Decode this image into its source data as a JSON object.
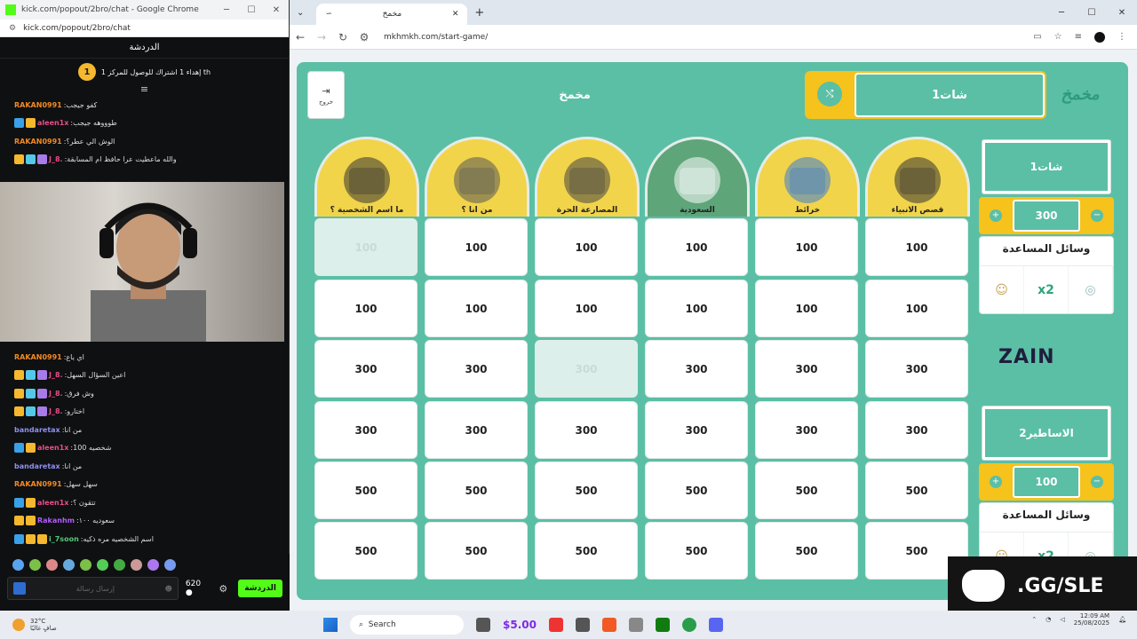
{
  "left_window": {
    "title": "kick.com/popout/2bro/chat - Google Chrome",
    "url": "kick.com/popout/2bro/chat",
    "chat_header": "الدردشة",
    "pinned": {
      "rank": "1",
      "text": "إهداء 1 اشتراك للوصول للمركز 1 th"
    },
    "messages_top": [
      {
        "user": "RAKAN0991",
        "text": "كفو جيجب",
        "color": "#f08a24",
        "badges": []
      },
      {
        "user": "aleen1x",
        "text": "طوووهه جيجب",
        "color": "#e84c8a",
        "badges": [
          "#3aa0e8",
          "#f5b82e"
        ]
      },
      {
        "user": "RAKAN0991",
        "text": "الوش الي عطر؟",
        "color": "#f08a24",
        "badges": []
      },
      {
        "user": "J_8.",
        "text": "والله ماعطيت عرا حافظ ام المسابقة",
        "color": "#e84c8a",
        "badges": [
          "#f5b82e",
          "#53c8e8",
          "#a77be8"
        ]
      }
    ],
    "messages_bottom": [
      {
        "user": "RAKAN0991",
        "text": "اي ياع",
        "color": "#f08a24",
        "badges": []
      },
      {
        "user": "J_8.",
        "text": "اعين السؤال السهل",
        "color": "#e84c8a",
        "badges": [
          "#f5b82e",
          "#53c8e8",
          "#a77be8"
        ]
      },
      {
        "user": "J_8.",
        "text": "وش فرق",
        "color": "#e84c8a",
        "badges": [
          "#f5b82e",
          "#53c8e8",
          "#a77be8"
        ]
      },
      {
        "user": "J_8.",
        "text": "اختارو",
        "color": "#e84c8a",
        "badges": [
          "#f5b82e",
          "#53c8e8",
          "#a77be8"
        ]
      },
      {
        "user": "bandaretax",
        "text": "من انا",
        "color": "#8f8ff0",
        "badges": []
      },
      {
        "user": "aleen1x",
        "text": "شخصيه 100",
        "color": "#e84c8a",
        "badges": [
          "#3aa0e8",
          "#f5b82e"
        ]
      },
      {
        "user": "bandaretax",
        "text": "من انا",
        "color": "#8f8ff0",
        "badges": []
      },
      {
        "user": "RAKAN0991",
        "text": "سهل سهل",
        "color": "#f08a24",
        "badges": []
      },
      {
        "user": "aleen1x",
        "text": "تتقون ؟",
        "color": "#e84c8a",
        "badges": [
          "#3aa0e8",
          "#f5b82e"
        ]
      },
      {
        "user": "Rakanhm",
        "text": "سعوديه ١٠٠",
        "color": "#b05cff",
        "badges": [
          "#f5b82e",
          "#f5b82e"
        ]
      },
      {
        "user": "i_7soon",
        "text": "اسم الشخصيه مره ذكيه",
        "color": "#53c87a",
        "badges": [
          "#3aa0e8",
          "#f5b82e",
          "#f5b82e"
        ]
      }
    ],
    "input_placeholder": "إرسال رسالة",
    "points": "620",
    "send_label": "الدردشة"
  },
  "browser": {
    "tab_title": "مخمخ",
    "url": "mkhmkh.com/start-game/"
  },
  "game": {
    "exit_label": "خروج",
    "title": "مخمخ",
    "current_team": "شات1",
    "logo": "مخمخ",
    "categories": [
      {
        "label": "ما اسم الشخصية ؟",
        "bg": "#f2d44a",
        "accent": "#333"
      },
      {
        "label": "من انا ؟",
        "bg": "#f2d44a",
        "accent": "#555"
      },
      {
        "label": "المصارعة الحرة",
        "bg": "#f2d44a",
        "accent": "#444"
      },
      {
        "label": "السعودية",
        "bg": "#5ea57a",
        "accent": "#fff"
      },
      {
        "label": "خرائط",
        "bg": "#f2d44a",
        "accent": "#3a7bd5"
      },
      {
        "label": "قصص الانبياء",
        "bg": "#f2d44a",
        "accent": "#333"
      }
    ],
    "rows": [
      [
        "100",
        "100",
        "100",
        "100",
        "100",
        "100"
      ],
      [
        "100",
        "100",
        "100",
        "100",
        "100",
        "100"
      ],
      [
        "300",
        "300",
        "300",
        "300",
        "300",
        "300"
      ],
      [
        "300",
        "300",
        "300",
        "300",
        "300",
        "300"
      ],
      [
        "500",
        "500",
        "500",
        "500",
        "500",
        "500"
      ],
      [
        "500",
        "500",
        "500",
        "500",
        "500",
        "500"
      ]
    ],
    "used": [
      [
        0,
        0
      ],
      [
        2,
        2
      ]
    ],
    "teams": [
      {
        "name": "شات1",
        "score": "300",
        "aids_title": "وسائل المساعدة",
        "aids": [
          "☺",
          "x2",
          "◎"
        ]
      },
      {
        "name": "الاساطير2",
        "score": "100",
        "aids_title": "وسائل المساعدة",
        "aids": [
          "☺",
          "x2",
          "◎"
        ]
      }
    ],
    "sponsor": "ZAIN"
  },
  "discord": {
    "text": ".GG/SLE"
  },
  "taskbar": {
    "temp": "32°C",
    "weather": "صافٍ غالبًا",
    "search": "Search",
    "money": "$5.00",
    "time": "12:09 AM",
    "date": "25/08/2025"
  }
}
